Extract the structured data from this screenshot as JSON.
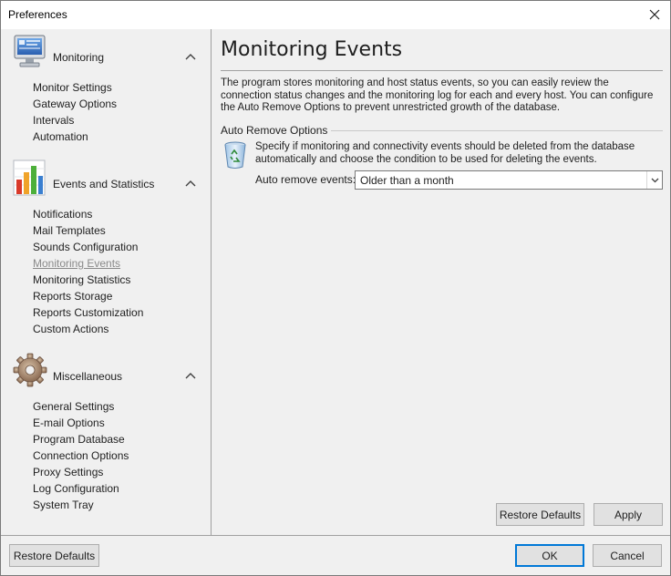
{
  "window": {
    "title": "Preferences"
  },
  "sidebar": {
    "groups": [
      {
        "title": "Monitoring",
        "icon": "monitor-icon",
        "items": [
          "Monitor Settings",
          "Gateway Options",
          "Intervals",
          "Automation"
        ]
      },
      {
        "title": "Events and Statistics",
        "icon": "bar-chart-icon",
        "items": [
          "Notifications",
          "Mail Templates",
          "Sounds Configuration",
          "Monitoring Events",
          "Monitoring Statistics",
          "Reports Storage",
          "Reports Customization",
          "Custom Actions"
        ],
        "selected": "Monitoring Events"
      },
      {
        "title": "Miscellaneous",
        "icon": "gear-icon",
        "items": [
          "General Settings",
          "E-mail Options",
          "Program Database",
          "Connection Options",
          "Proxy Settings",
          "Log Configuration",
          "System Tray"
        ]
      }
    ]
  },
  "main": {
    "title": "Monitoring Events",
    "description_lines": [
      "The program stores monitoring and host status events, so you can easily review the",
      "connection status changes and the monitoring log for each and every host. You can configure",
      "the Auto Remove Options to prevent unrestricted growth of the database."
    ],
    "section": {
      "title": "Auto Remove Options",
      "icon": "recycle-bin-icon",
      "description_lines": [
        "Specify if monitoring and connectivity events should be deleted from the database",
        "automatically and choose the condition to be used for deleting the events."
      ],
      "field_label": "Auto remove events:",
      "field_value": "Older than a month"
    },
    "buttons": {
      "restore_defaults": "Restore Defaults",
      "apply": "Apply"
    }
  },
  "footer": {
    "restore_defaults": "Restore Defaults",
    "ok": "OK",
    "cancel": "Cancel"
  },
  "colors": {
    "accent": "#0078d7",
    "panel": "#f0f0f0",
    "selected_text": "#8a8a8a"
  }
}
